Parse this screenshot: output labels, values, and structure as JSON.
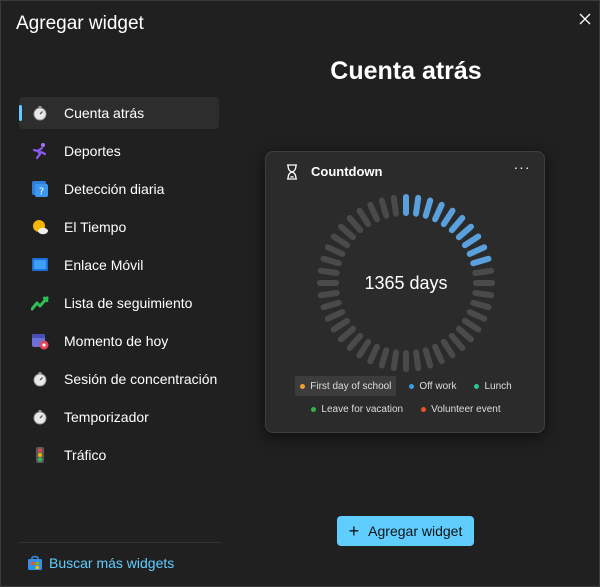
{
  "window": {
    "title": "Agregar widget"
  },
  "sidebar": {
    "items": [
      {
        "label": "Cuenta atrás",
        "icon": "stopwatch-icon"
      },
      {
        "label": "Deportes",
        "icon": "runner-icon"
      },
      {
        "label": "Detección diaria",
        "icon": "question-tile-icon"
      },
      {
        "label": "El Tiempo",
        "icon": "sun-cloud-icon"
      },
      {
        "label": "Enlace Móvil",
        "icon": "phone-link-icon"
      },
      {
        "label": "Lista de seguimiento",
        "icon": "stock-chart-icon"
      },
      {
        "label": "Momento de hoy",
        "icon": "calendar-star-icon"
      },
      {
        "label": "Sesión de concentración",
        "icon": "stopwatch-icon"
      },
      {
        "label": "Temporizador",
        "icon": "stopwatch-icon"
      },
      {
        "label": "Tráfico",
        "icon": "traffic-light-icon"
      }
    ],
    "more_link": "Buscar más widgets"
  },
  "main": {
    "heading": "Cuenta atrás",
    "add_button": "Agregar widget"
  },
  "widget": {
    "title": "Countdown",
    "days": "1365 days",
    "progress": 0.22,
    "legend": [
      {
        "label": "First day of school",
        "color": "#f0a030",
        "selected": true
      },
      {
        "label": "Off work",
        "color": "#3a9be0"
      },
      {
        "label": "Lunch",
        "color": "#2fc48a"
      },
      {
        "label": "Leave for vacation",
        "color": "#35b04a"
      },
      {
        "label": "Volunteer event",
        "color": "#e8542a"
      }
    ]
  },
  "colors": {
    "accent": "#60cdff",
    "background": "#202020",
    "card": "#2b2b2b",
    "ring_active": "#5aa0dc",
    "ring_inactive": "#4a4a4a"
  }
}
